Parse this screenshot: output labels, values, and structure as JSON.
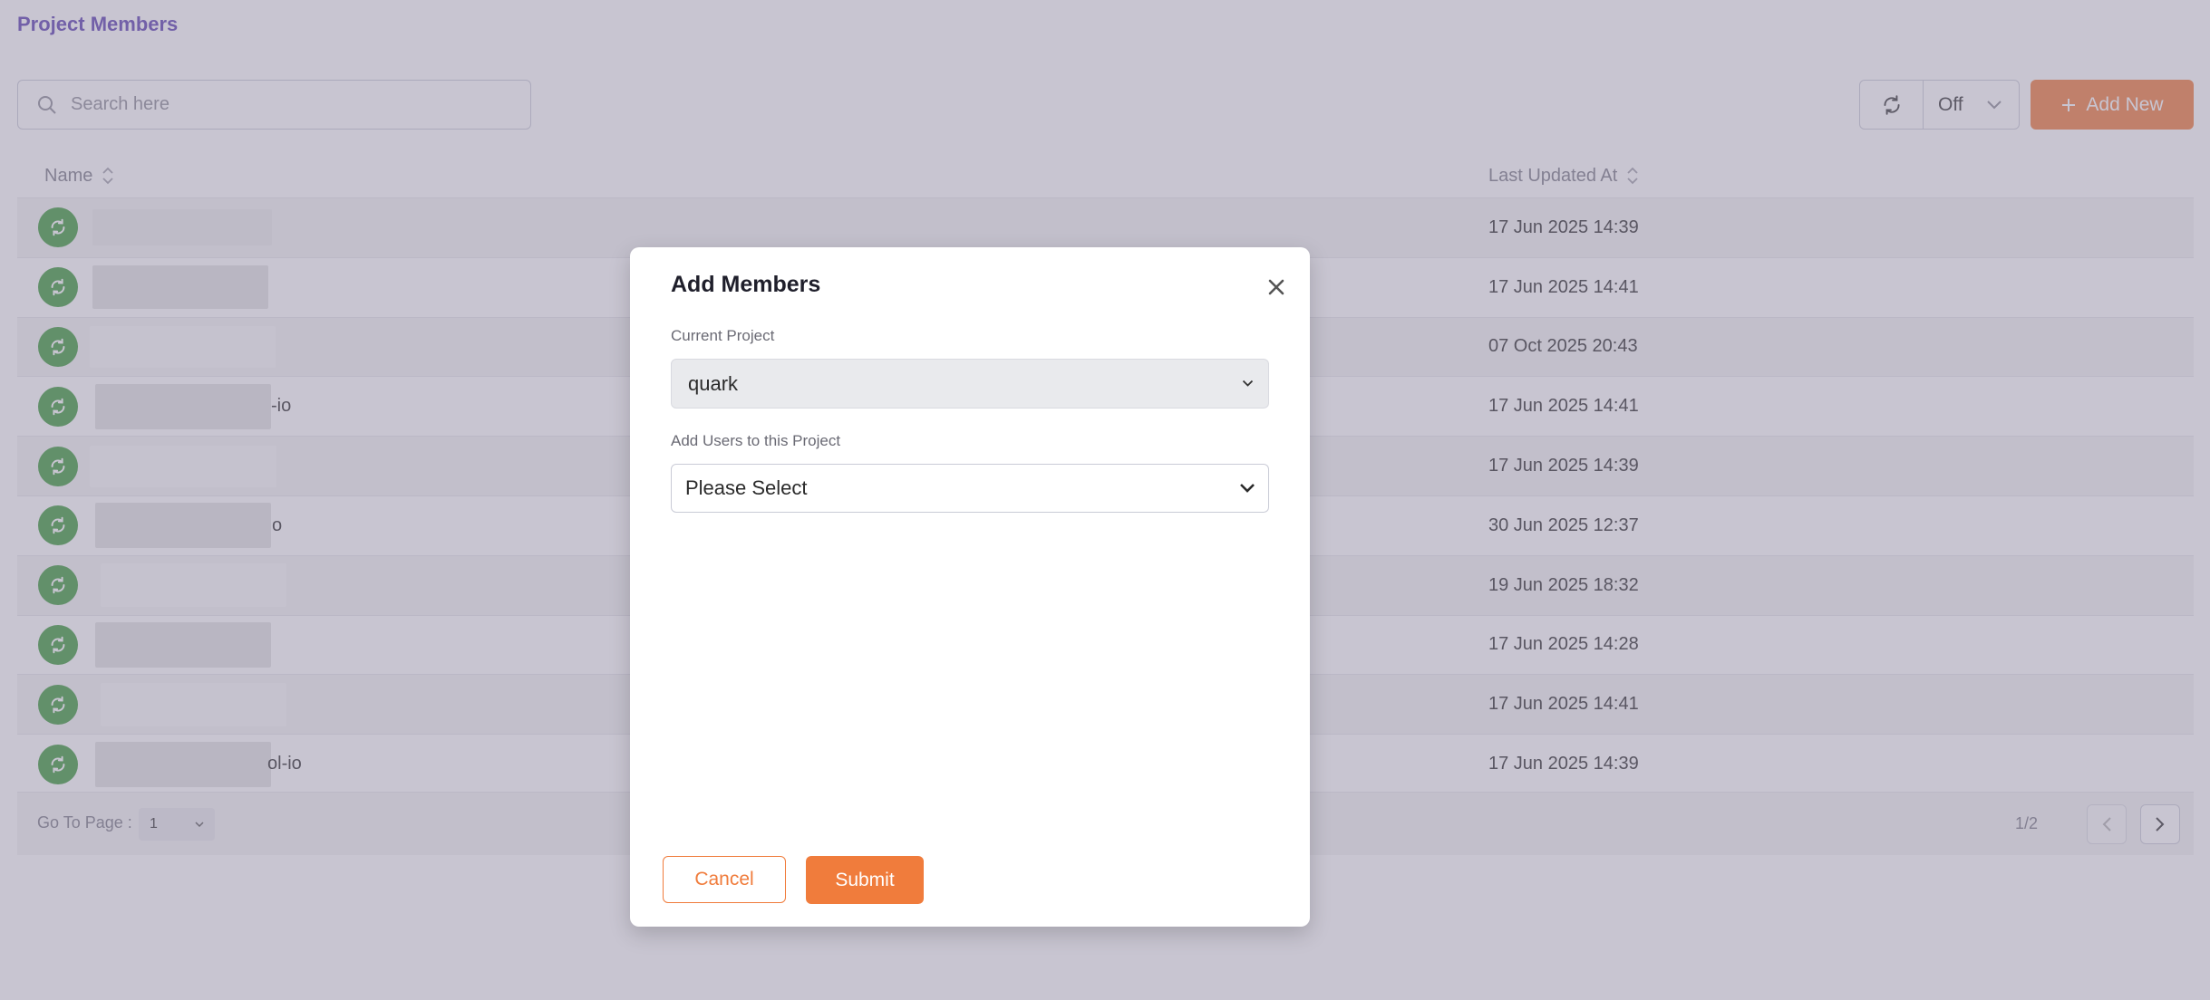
{
  "page": {
    "title": "Project Members"
  },
  "search": {
    "placeholder": "Search here",
    "value": ""
  },
  "refresh": {
    "interval_value": "Off"
  },
  "toolbar": {
    "add_new_label": "Add New"
  },
  "table": {
    "columns": [
      "Name",
      "Last Updated At"
    ],
    "rows": [
      {
        "name_suffix": "",
        "updated": "17 Jun 2025 14:39"
      },
      {
        "name_suffix": "",
        "updated": "17 Jun 2025 14:41"
      },
      {
        "name_suffix": "",
        "updated": "07 Oct 2025 20:43"
      },
      {
        "name_suffix": "-io",
        "updated": "17 Jun 2025 14:41"
      },
      {
        "name_suffix": "",
        "updated": "17 Jun 2025 14:39"
      },
      {
        "name_suffix": "o",
        "updated": "30 Jun 2025 12:37"
      },
      {
        "name_suffix": "",
        "updated": "19 Jun 2025 18:32"
      },
      {
        "name_suffix": "",
        "updated": "17 Jun 2025 14:28"
      },
      {
        "name_suffix": "",
        "updated": "17 Jun 2025 14:41"
      },
      {
        "name_suffix": "ol-io",
        "updated": "17 Jun 2025 14:39"
      }
    ]
  },
  "pagination": {
    "goto_label": "Go To Page :",
    "current_page": "1",
    "page_count": "1/2"
  },
  "modal": {
    "title": "Add Members",
    "current_project_label": "Current Project",
    "current_project_value": "quark",
    "add_users_label": "Add Users to this Project",
    "add_users_placeholder": "Please Select",
    "cancel_label": "Cancel",
    "submit_label": "Submit"
  },
  "colors": {
    "accent": "#f07c3c",
    "title": "#5b3fb0",
    "status_green": "#3c9a3a",
    "overlay": "#8c869e"
  },
  "icons": {
    "search": "search-icon",
    "refresh": "refresh-icon",
    "chevron": "chevron-down-icon",
    "plus": "plus-icon",
    "sort": "sort-icon",
    "status": "sync-status-icon",
    "close": "close-icon",
    "prev": "chevron-left-icon",
    "next": "chevron-right-icon"
  }
}
